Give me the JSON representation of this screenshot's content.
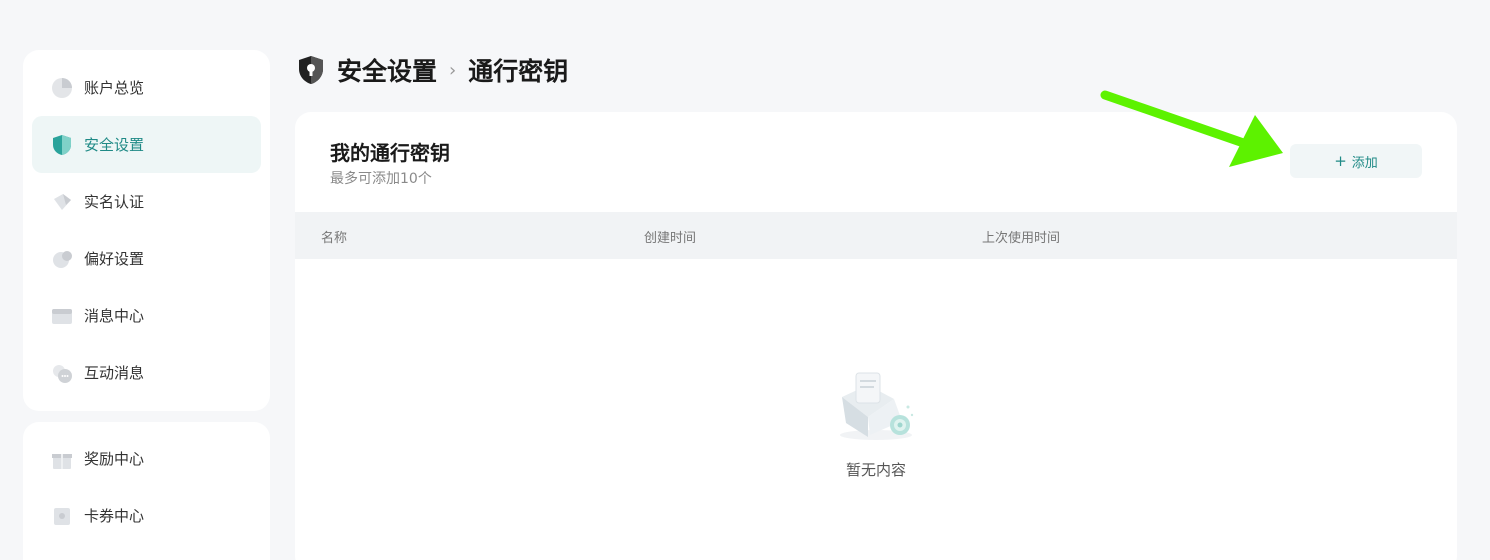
{
  "sidebar": {
    "primary_items": [
      {
        "label": "账户总览",
        "icon": "pie-chart-icon"
      },
      {
        "label": "安全设置",
        "icon": "shield-icon",
        "active": true
      },
      {
        "label": "实名认证",
        "icon": "id-card-icon"
      },
      {
        "label": "偏好设置",
        "icon": "preferences-icon"
      },
      {
        "label": "消息中心",
        "icon": "inbox-icon"
      },
      {
        "label": "互动消息",
        "icon": "chat-bubble-icon"
      }
    ],
    "secondary_items": [
      {
        "label": "奖励中心",
        "icon": "gift-icon"
      },
      {
        "label": "卡券中心",
        "icon": "coupon-icon"
      }
    ]
  },
  "breadcrumb": {
    "parent": "安全设置",
    "separator": "›",
    "current": "通行密钥"
  },
  "passkeys": {
    "title": "我的通行密钥",
    "subtitle": "最多可添加10个",
    "add_button": {
      "icon": "+",
      "label": "添加"
    },
    "columns": [
      "名称",
      "创建时间",
      "上次使用时间"
    ],
    "empty_text": "暂无内容"
  },
  "colors": {
    "accent": "#1f8a86",
    "annotation_arrow": "#5df200"
  }
}
